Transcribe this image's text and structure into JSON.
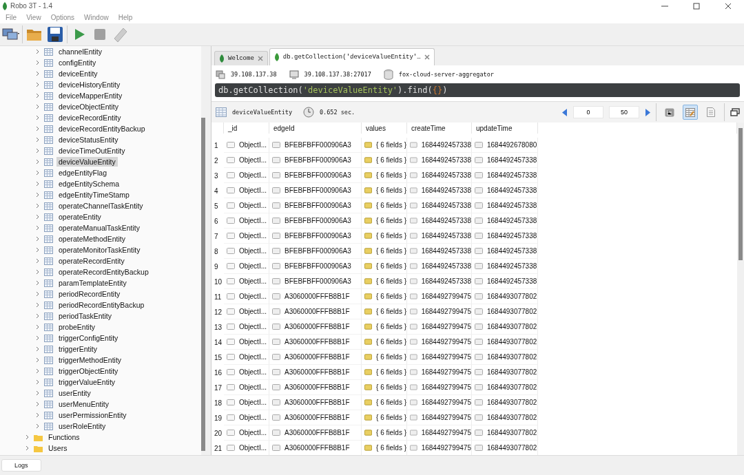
{
  "window": {
    "title": "Robo 3T - 1.4"
  },
  "menu": [
    "File",
    "View",
    "Options",
    "Window",
    "Help"
  ],
  "sidebar": {
    "tree": [
      {
        "children": [
          {
            "label": "channelEntity",
            "selected": false
          },
          {
            "label": "configEntity",
            "selected": false
          },
          {
            "label": "deviceEntity",
            "selected": false
          },
          {
            "label": "deviceHistoryEntity",
            "selected": false
          },
          {
            "label": "deviceMapperEntity",
            "selected": false
          },
          {
            "label": "deviceObjectEntity",
            "selected": false
          },
          {
            "label": "deviceRecordEntity",
            "selected": false
          },
          {
            "label": "deviceRecordEntityBackup",
            "selected": false
          },
          {
            "label": "deviceStatusEntity",
            "selected": false
          },
          {
            "label": "deviceTimeOutEntity",
            "selected": false
          },
          {
            "label": "deviceValueEntity",
            "selected": true
          },
          {
            "label": "edgeEntityFlag",
            "selected": false
          },
          {
            "label": "edgeEntitySchema",
            "selected": false
          },
          {
            "label": "edgeEntityTimeStamp",
            "selected": false
          },
          {
            "label": "operateChannelTaskEntity",
            "selected": false
          },
          {
            "label": "operateEntity",
            "selected": false
          },
          {
            "label": "operateManualTaskEntity",
            "selected": false
          },
          {
            "label": "operateMethodEntity",
            "selected": false
          },
          {
            "label": "operateMonitorTaskEntity",
            "selected": false
          },
          {
            "label": "operateRecordEntity",
            "selected": false
          },
          {
            "label": "operateRecordEntityBackup",
            "selected": false
          },
          {
            "label": "paramTemplateEntity",
            "selected": false
          },
          {
            "label": "periodRecordEntity",
            "selected": false
          },
          {
            "label": "periodRecordEntityBackup",
            "selected": false
          },
          {
            "label": "periodTaskEntity",
            "selected": false
          },
          {
            "label": "probeEntity",
            "selected": false
          },
          {
            "label": "triggerConfigEntity",
            "selected": false
          },
          {
            "label": "triggerEntity",
            "selected": false
          },
          {
            "label": "triggerMethodEntity",
            "selected": false
          },
          {
            "label": "triggerObjectEntity",
            "selected": false
          },
          {
            "label": "triggerValueEntity",
            "selected": false
          },
          {
            "label": "userEntity",
            "selected": false
          },
          {
            "label": "userMenuEntity",
            "selected": false
          },
          {
            "label": "userPermissionEntity",
            "selected": false
          },
          {
            "label": "userRoleEntity",
            "selected": false
          }
        ]
      },
      {
        "label": "Functions",
        "expanded": false,
        "selected": false
      },
      {
        "label": "Users",
        "expanded": false,
        "selected": false
      }
    ]
  },
  "tabs": [
    {
      "label": "Welcome",
      "selected": false
    },
    {
      "label": "db.getCollection('deviceValueEntity'…",
      "selected": true
    }
  ],
  "connection": {
    "server": "39.108.137.38",
    "address": "39.108.137.38:27017",
    "database": "fox-cloud-server-aggregator"
  },
  "query": [
    {
      "kind": "plain",
      "text": "db.getCollection("
    },
    {
      "kind": "string",
      "text": "'deviceValueEntity'"
    },
    {
      "kind": "plain",
      "text": ").find("
    },
    {
      "kind": "brace",
      "text": "{}"
    },
    {
      "kind": "plain",
      "text": ")"
    }
  ],
  "results": {
    "collection": "deviceValueEntity",
    "time": "0.652 sec.",
    "skip": "0",
    "limit": "50",
    "view_modes": [
      {
        "kind": "tree",
        "selected": false
      },
      {
        "kind": "table",
        "selected": true
      },
      {
        "kind": "text",
        "selected": false
      }
    ]
  },
  "table": {
    "columns": [
      "_id",
      "edgeId",
      "values",
      "createTime",
      "updateTime"
    ],
    "rows": [
      {
        "number": "1",
        "cells": [
          "ObjectI...",
          "BFEBFBFF000906A3",
          "{ 6 fields }",
          "1684492457338",
          "1684492678080"
        ]
      },
      {
        "number": "2",
        "cells": [
          "ObjectI...",
          "BFEBFBFF000906A3",
          "{ 6 fields }",
          "1684492457338",
          "1684492457338"
        ]
      },
      {
        "number": "3",
        "cells": [
          "ObjectI...",
          "BFEBFBFF000906A3",
          "{ 6 fields }",
          "1684492457338",
          "1684492457338"
        ]
      },
      {
        "number": "4",
        "cells": [
          "ObjectI...",
          "BFEBFBFF000906A3",
          "{ 6 fields }",
          "1684492457338",
          "1684492457338"
        ]
      },
      {
        "number": "5",
        "cells": [
          "ObjectI...",
          "BFEBFBFF000906A3",
          "{ 6 fields }",
          "1684492457338",
          "1684492457338"
        ]
      },
      {
        "number": "6",
        "cells": [
          "ObjectI...",
          "BFEBFBFF000906A3",
          "{ 6 fields }",
          "1684492457338",
          "1684492457338"
        ]
      },
      {
        "number": "7",
        "cells": [
          "ObjectI...",
          "BFEBFBFF000906A3",
          "{ 6 fields }",
          "1684492457338",
          "1684492457338"
        ]
      },
      {
        "number": "8",
        "cells": [
          "ObjectI...",
          "BFEBFBFF000906A3",
          "{ 6 fields }",
          "1684492457338",
          "1684492457338"
        ]
      },
      {
        "number": "9",
        "cells": [
          "ObjectI...",
          "BFEBFBFF000906A3",
          "{ 6 fields }",
          "1684492457338",
          "1684492457338"
        ]
      },
      {
        "number": "10",
        "cells": [
          "ObjectI...",
          "BFEBFBFF000906A3",
          "{ 6 fields }",
          "1684492457338",
          "1684492457338"
        ]
      },
      {
        "number": "11",
        "cells": [
          "ObjectI...",
          "A3060000FFFB8B1F",
          "{ 6 fields }",
          "1684492799475",
          "1684493077802"
        ]
      },
      {
        "number": "12",
        "cells": [
          "ObjectI...",
          "A3060000FFFB8B1F",
          "{ 6 fields }",
          "1684492799475",
          "1684493077802"
        ]
      },
      {
        "number": "13",
        "cells": [
          "ObjectI...",
          "A3060000FFFB8B1F",
          "{ 6 fields }",
          "1684492799475",
          "1684493077802"
        ]
      },
      {
        "number": "14",
        "cells": [
          "ObjectI...",
          "A3060000FFFB8B1F",
          "{ 6 fields }",
          "1684492799475",
          "1684493077802"
        ]
      },
      {
        "number": "15",
        "cells": [
          "ObjectI...",
          "A3060000FFFB8B1F",
          "{ 6 fields }",
          "1684492799475",
          "1684493077802"
        ]
      },
      {
        "number": "16",
        "cells": [
          "ObjectI...",
          "A3060000FFFB8B1F",
          "{ 6 fields }",
          "1684492799475",
          "1684493077802"
        ]
      },
      {
        "number": "17",
        "cells": [
          "ObjectI...",
          "A3060000FFFB8B1F",
          "{ 6 fields }",
          "1684492799475",
          "1684493077802"
        ]
      },
      {
        "number": "18",
        "cells": [
          "ObjectI...",
          "A3060000FFFB8B1F",
          "{ 6 fields }",
          "1684492799475",
          "1684493077802"
        ]
      },
      {
        "number": "19",
        "cells": [
          "ObjectI...",
          "A3060000FFFB8B1F",
          "{ 6 fields }",
          "1684492799475",
          "1684493077802"
        ]
      },
      {
        "number": "20",
        "cells": [
          "ObjectI...",
          "A3060000FFFB8B1F",
          "{ 6 fields }",
          "1684492799475",
          "1684493077802"
        ]
      },
      {
        "number": "21",
        "cells": [
          "ObjectI...",
          "A3060000FFFB8B1F",
          "{ 6 fields }",
          "1684492799475",
          "1684493077802"
        ]
      }
    ]
  },
  "bottom_tabs": [
    {
      "label": "Logs",
      "selected": true
    }
  ]
}
